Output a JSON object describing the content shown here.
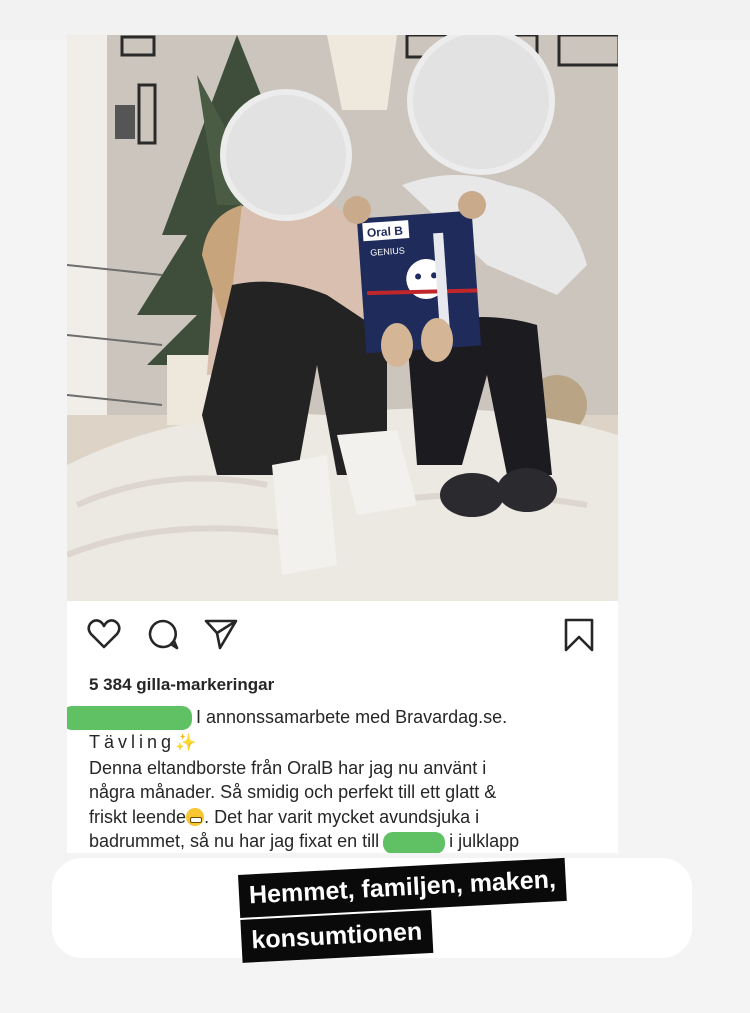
{
  "post": {
    "likes": "5 384 gilla-markeringar",
    "caption_line1_text": "I annonssamarbete med Bravardag.se.",
    "caption_line2_text": "Tävling",
    "caption_line2_emoji": "✨",
    "caption_line3": "Denna eltandborste från OralB har jag nu använt i",
    "caption_line4": "några månader. Så smidig och perfekt till ett glatt &",
    "caption_line5_a": "friskt leende",
    "caption_line5_b": ". Det har varit mycket avundsjuka i",
    "caption_line6_a": "badrummet, så nu har jag fixat en till",
    "caption_line6_b": "i julklapp",
    "product_brand": "Oral B",
    "product_model": "GENIUS"
  },
  "icons": {
    "like": "heart-icon",
    "comment": "comment-icon",
    "share": "send-icon",
    "save": "bookmark-icon"
  },
  "sticker": {
    "line1": "Hemmet, familjen, maken,",
    "line2": "konsumtionen"
  },
  "colors": {
    "redaction": "#5fc163",
    "sticker_bg": "#0a0a0a",
    "sticker_text": "#ffffff"
  }
}
